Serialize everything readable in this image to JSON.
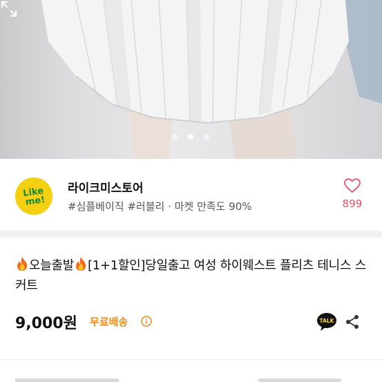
{
  "hero": {
    "image_alt": "white pleated skirt product photo",
    "carousel": {
      "total": 3,
      "active_index": 2
    },
    "expand_icon": "expand-icon"
  },
  "seller": {
    "logo_text_line1": "Like",
    "logo_text_line2": "me!",
    "name": "라이크미스토어",
    "tags": "#심플베이직 #러블리 · 마켓 만족도 90%",
    "like_icon": "heart-icon",
    "like_count": "899"
  },
  "product": {
    "badge_icon": "fire-icon",
    "title_part1": "오늘출발",
    "title_part2": "[1+1할인]당일출고 여성 하이웨스트 플리츠 테니스 스커트",
    "price": "9,000원",
    "shipping": "무료배송",
    "info_icon": "info-icon",
    "talk_icon": "kakaotalk-icon",
    "talk_label": "TALK",
    "share_icon": "share-icon"
  },
  "colors": {
    "accent_like": "#e8506a",
    "shipping": "#f08c1a",
    "logo_bg": "#f4cf12",
    "logo_text": "#1a8a3a"
  }
}
